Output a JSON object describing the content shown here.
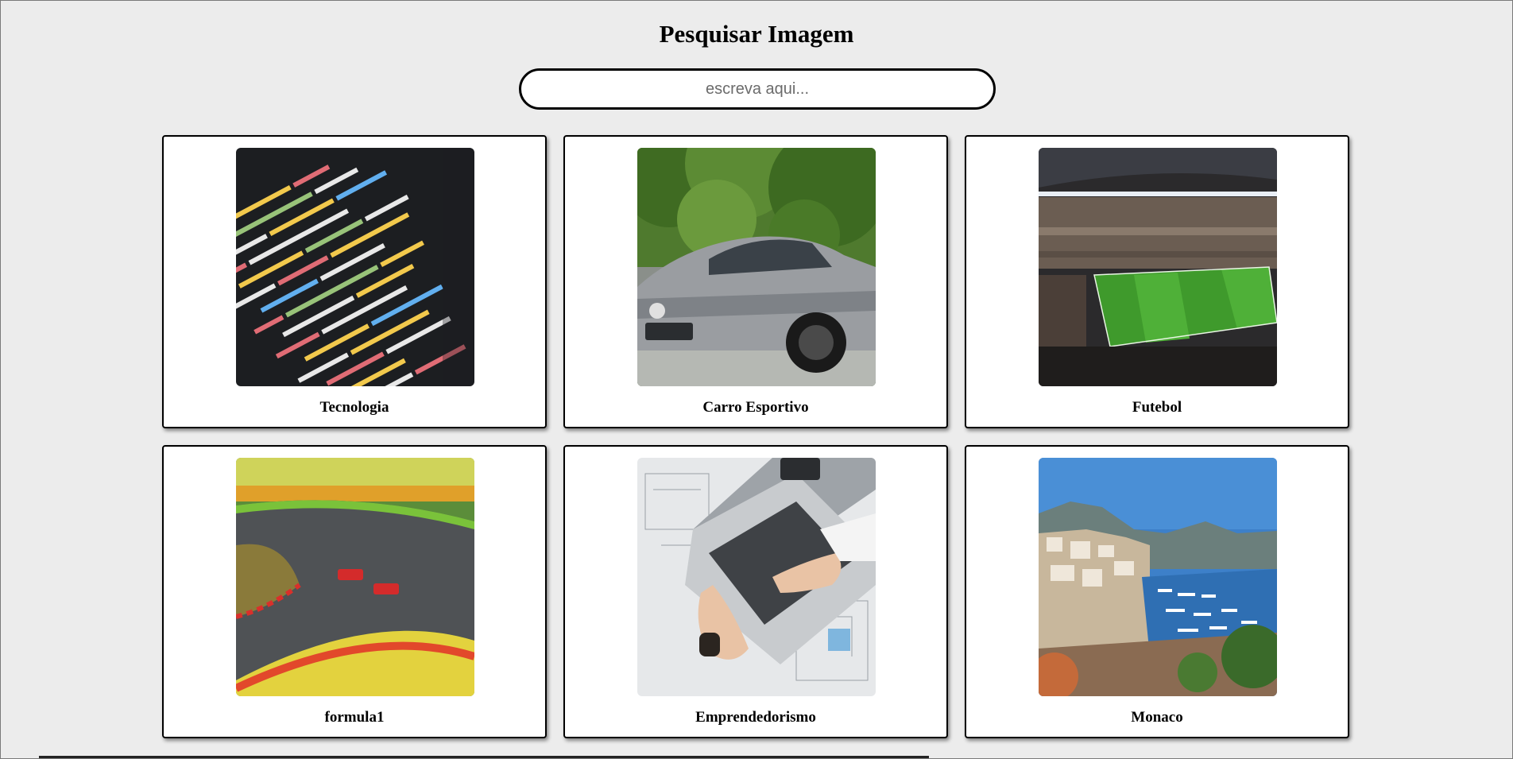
{
  "header": {
    "title": "Pesquisar Imagem"
  },
  "search": {
    "placeholder": "escreva aqui..."
  },
  "cards": [
    {
      "label": "Tecnologia",
      "image": "code-editor-photo"
    },
    {
      "label": "Carro Esportivo",
      "image": "sports-car-photo"
    },
    {
      "label": "Futebol",
      "image": "football-stadium-photo"
    },
    {
      "label": "formula1",
      "image": "formula1-race-photo"
    },
    {
      "label": "Emprendedorismo",
      "image": "laptop-blueprints-photo"
    },
    {
      "label": "Monaco",
      "image": "monaco-harbor-photo"
    }
  ]
}
